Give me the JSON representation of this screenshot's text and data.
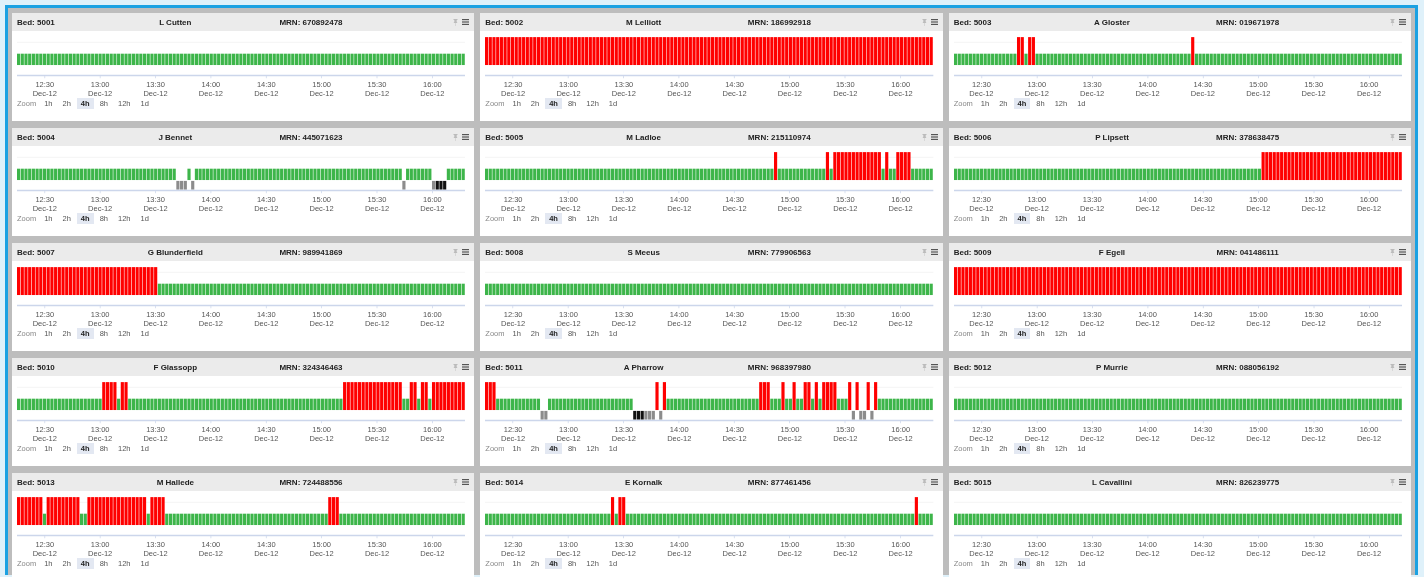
{
  "beds": [
    {
      "bed": "Bed: 5001",
      "patient": "L Cutten",
      "mrn": "MRN: 670892478",
      "segments": [
        {
          "kind": "normal"
        }
      ],
      "axis": [
        {
          "time": "12:30",
          "date": "Dec-12"
        },
        {
          "time": "13:00",
          "date": "Dec-12"
        },
        {
          "time": "13:30",
          "date": "Dec-12"
        },
        {
          "time": "14:00",
          "date": "Dec-12"
        },
        {
          "time": "14:30",
          "date": "Dec-12"
        },
        {
          "time": "15:00",
          "date": "Dec-12"
        },
        {
          "time": "15:30",
          "date": "Dec-12"
        },
        {
          "time": "16:00",
          "date": "Dec-12"
        }
      ],
      "zoom": {
        "label": "Zoom",
        "options": [
          {
            "label": "1h",
            "selected": false
          },
          {
            "label": "2h",
            "selected": false
          },
          {
            "label": "4h",
            "selected": true
          },
          {
            "label": "8h",
            "selected": false
          },
          {
            "label": "12h",
            "selected": false
          },
          {
            "label": "1d",
            "selected": false
          }
        ]
      }
    },
    {
      "bed": "Bed: 5002",
      "patient": "M Lelliott",
      "mrn": "MRN: 186992918",
      "segments": [
        {
          "kind": "alarm"
        }
      ],
      "axis": [
        {
          "time": "12:30",
          "date": "Dec-12"
        },
        {
          "time": "13:00",
          "date": "Dec-12"
        },
        {
          "time": "13:30",
          "date": "Dec-12"
        },
        {
          "time": "14:00",
          "date": "Dec-12"
        },
        {
          "time": "14:30",
          "date": "Dec-12"
        },
        {
          "time": "15:00",
          "date": "Dec-12"
        },
        {
          "time": "15:30",
          "date": "Dec-12"
        },
        {
          "time": "16:00",
          "date": "Dec-12"
        }
      ],
      "zoom": {
        "label": "Zoom",
        "options": [
          {
            "label": "1h",
            "selected": false
          },
          {
            "label": "2h",
            "selected": false
          },
          {
            "label": "4h",
            "selected": true
          },
          {
            "label": "8h",
            "selected": false
          },
          {
            "label": "12h",
            "selected": false
          },
          {
            "label": "1d",
            "selected": false
          }
        ]
      }
    },
    {
      "bed": "Bed: 5003",
      "patient": "A Gloster",
      "mrn": "MRN: 019671978",
      "segments": [
        {
          "kind": "normal"
        },
        {
          "kind": "alarm"
        },
        {
          "kind": "normal"
        },
        {
          "kind": "alarm"
        },
        {
          "kind": "normal"
        },
        {
          "kind": "alarm"
        },
        {
          "kind": "normal"
        }
      ],
      "axis": [
        {
          "time": "12:30",
          "date": "Dec-12"
        },
        {
          "time": "13:00",
          "date": "Dec-12"
        },
        {
          "time": "13:30",
          "date": "Dec-12"
        },
        {
          "time": "14:00",
          "date": "Dec-12"
        },
        {
          "time": "14:30",
          "date": "Dec-12"
        },
        {
          "time": "15:00",
          "date": "Dec-12"
        },
        {
          "time": "15:30",
          "date": "Dec-12"
        },
        {
          "time": "16:00",
          "date": "Dec-12"
        }
      ],
      "zoom": {
        "label": "Zoom",
        "options": [
          {
            "label": "1h",
            "selected": false
          },
          {
            "label": "2h",
            "selected": false
          },
          {
            "label": "4h",
            "selected": true
          },
          {
            "label": "8h",
            "selected": false
          },
          {
            "label": "12h",
            "selected": false
          },
          {
            "label": "1d",
            "selected": false
          }
        ]
      }
    },
    {
      "bed": "Bed: 5004",
      "patient": "J Bennet",
      "mrn": "MRN: 445071623",
      "segments": [
        {
          "kind": "normal"
        },
        {
          "kind": "gap"
        },
        {
          "kind": "normal"
        },
        {
          "kind": "gap"
        },
        {
          "kind": "normal"
        },
        {
          "kind": "gap"
        },
        {
          "kind": "normal"
        },
        {
          "kind": "gap"
        },
        {
          "kind": "dark_gap"
        },
        {
          "kind": "normal"
        }
      ],
      "axis": [
        {
          "time": "12:30",
          "date": "Dec-12"
        },
        {
          "time": "13:00",
          "date": "Dec-12"
        },
        {
          "time": "13:30",
          "date": "Dec-12"
        },
        {
          "time": "14:00",
          "date": "Dec-12"
        },
        {
          "time": "14:30",
          "date": "Dec-12"
        },
        {
          "time": "15:00",
          "date": "Dec-12"
        },
        {
          "time": "15:30",
          "date": "Dec-12"
        },
        {
          "time": "16:00",
          "date": "Dec-12"
        }
      ],
      "zoom": {
        "label": "Zoom",
        "options": [
          {
            "label": "1h",
            "selected": false
          },
          {
            "label": "2h",
            "selected": false
          },
          {
            "label": "4h",
            "selected": true
          },
          {
            "label": "8h",
            "selected": false
          },
          {
            "label": "12h",
            "selected": false
          },
          {
            "label": "1d",
            "selected": false
          }
        ]
      }
    },
    {
      "bed": "Bed: 5005",
      "patient": "M Ladloe",
      "mrn": "MRN: 215110974",
      "segments": [
        {
          "kind": "normal"
        },
        {
          "kind": "alarm"
        },
        {
          "kind": "normal"
        },
        {
          "kind": "alarm"
        },
        {
          "kind": "normal"
        },
        {
          "kind": "alarm"
        },
        {
          "kind": "normal"
        },
        {
          "kind": "alarm"
        },
        {
          "kind": "normal"
        },
        {
          "kind": "alarm"
        },
        {
          "kind": "normal"
        }
      ],
      "axis": [
        {
          "time": "12:30",
          "date": "Dec-12"
        },
        {
          "time": "13:00",
          "date": "Dec-12"
        },
        {
          "time": "13:30",
          "date": "Dec-12"
        },
        {
          "time": "14:00",
          "date": "Dec-12"
        },
        {
          "time": "14:30",
          "date": "Dec-12"
        },
        {
          "time": "15:00",
          "date": "Dec-12"
        },
        {
          "time": "15:30",
          "date": "Dec-12"
        },
        {
          "time": "16:00",
          "date": "Dec-12"
        }
      ],
      "zoom": {
        "label": "Zoom",
        "options": [
          {
            "label": "1h",
            "selected": false
          },
          {
            "label": "2h",
            "selected": false
          },
          {
            "label": "4h",
            "selected": true
          },
          {
            "label": "8h",
            "selected": false
          },
          {
            "label": "12h",
            "selected": false
          },
          {
            "label": "1d",
            "selected": false
          }
        ]
      }
    },
    {
      "bed": "Bed: 5006",
      "patient": "P Lipsett",
      "mrn": "MRN: 378638475",
      "segments": [
        {
          "kind": "normal"
        },
        {
          "kind": "alarm"
        }
      ],
      "axis": [
        {
          "time": "12:30",
          "date": "Dec-12"
        },
        {
          "time": "13:00",
          "date": "Dec-12"
        },
        {
          "time": "13:30",
          "date": "Dec-12"
        },
        {
          "time": "14:00",
          "date": "Dec-12"
        },
        {
          "time": "14:30",
          "date": "Dec-12"
        },
        {
          "time": "15:00",
          "date": "Dec-12"
        },
        {
          "time": "15:30",
          "date": "Dec-12"
        },
        {
          "time": "16:00",
          "date": "Dec-12"
        }
      ],
      "zoom": {
        "label": "Zoom",
        "options": [
          {
            "label": "1h",
            "selected": false
          },
          {
            "label": "2h",
            "selected": false
          },
          {
            "label": "4h",
            "selected": true
          },
          {
            "label": "8h",
            "selected": false
          },
          {
            "label": "12h",
            "selected": false
          },
          {
            "label": "1d",
            "selected": false
          }
        ]
      }
    },
    {
      "bed": "Bed: 5007",
      "patient": "G Blunderfield",
      "mrn": "MRN: 989941869",
      "segments": [
        {
          "kind": "alarm"
        },
        {
          "kind": "normal"
        }
      ],
      "axis": [
        {
          "time": "12:30",
          "date": "Dec-12"
        },
        {
          "time": "13:00",
          "date": "Dec-12"
        },
        {
          "time": "13:30",
          "date": "Dec-12"
        },
        {
          "time": "14:00",
          "date": "Dec-12"
        },
        {
          "time": "14:30",
          "date": "Dec-12"
        },
        {
          "time": "15:00",
          "date": "Dec-12"
        },
        {
          "time": "15:30",
          "date": "Dec-12"
        },
        {
          "time": "16:00",
          "date": "Dec-12"
        }
      ],
      "zoom": {
        "label": "Zoom",
        "options": [
          {
            "label": "1h",
            "selected": false
          },
          {
            "label": "2h",
            "selected": false
          },
          {
            "label": "4h",
            "selected": true
          },
          {
            "label": "8h",
            "selected": false
          },
          {
            "label": "12h",
            "selected": false
          },
          {
            "label": "1d",
            "selected": false
          }
        ]
      }
    },
    {
      "bed": "Bed: 5008",
      "patient": "S Meeus",
      "mrn": "MRN: 779906563",
      "segments": [
        {
          "kind": "normal"
        }
      ],
      "axis": [
        {
          "time": "12:30",
          "date": "Dec-12"
        },
        {
          "time": "13:00",
          "date": "Dec-12"
        },
        {
          "time": "13:30",
          "date": "Dec-12"
        },
        {
          "time": "14:00",
          "date": "Dec-12"
        },
        {
          "time": "14:30",
          "date": "Dec-12"
        },
        {
          "time": "15:00",
          "date": "Dec-12"
        },
        {
          "time": "15:30",
          "date": "Dec-12"
        },
        {
          "time": "16:00",
          "date": "Dec-12"
        }
      ],
      "zoom": {
        "label": "Zoom",
        "options": [
          {
            "label": "1h",
            "selected": false
          },
          {
            "label": "2h",
            "selected": false
          },
          {
            "label": "4h",
            "selected": true
          },
          {
            "label": "8h",
            "selected": false
          },
          {
            "label": "12h",
            "selected": false
          },
          {
            "label": "1d",
            "selected": false
          }
        ]
      }
    },
    {
      "bed": "Bed: 5009",
      "patient": "F Egell",
      "mrn": "MRN: 041486111",
      "segments": [
        {
          "kind": "alarm"
        }
      ],
      "axis": [
        {
          "time": "12:30",
          "date": "Dec-12"
        },
        {
          "time": "13:00",
          "date": "Dec-12"
        },
        {
          "time": "13:30",
          "date": "Dec-12"
        },
        {
          "time": "14:00",
          "date": "Dec-12"
        },
        {
          "time": "14:30",
          "date": "Dec-12"
        },
        {
          "time": "15:00",
          "date": "Dec-12"
        },
        {
          "time": "15:30",
          "date": "Dec-12"
        },
        {
          "time": "16:00",
          "date": "Dec-12"
        }
      ],
      "zoom": {
        "label": "Zoom",
        "options": [
          {
            "label": "1h",
            "selected": false
          },
          {
            "label": "2h",
            "selected": false
          },
          {
            "label": "4h",
            "selected": true
          },
          {
            "label": "8h",
            "selected": false
          },
          {
            "label": "12h",
            "selected": false
          },
          {
            "label": "1d",
            "selected": false
          }
        ]
      }
    },
    {
      "bed": "Bed: 5010",
      "patient": "F Glassopp",
      "mrn": "MRN: 324346463",
      "segments": [
        {
          "kind": "normal"
        },
        {
          "kind": "alarm"
        },
        {
          "kind": "normal"
        },
        {
          "kind": "alarm"
        },
        {
          "kind": "normal"
        },
        {
          "kind": "alarm"
        },
        {
          "kind": "normal"
        },
        {
          "kind": "alarm"
        },
        {
          "kind": "normal"
        },
        {
          "kind": "alarm"
        },
        {
          "kind": "normal"
        },
        {
          "kind": "alarm"
        }
      ],
      "axis": [
        {
          "time": "12:30",
          "date": "Dec-12"
        },
        {
          "time": "13:00",
          "date": "Dec-12"
        },
        {
          "time": "13:30",
          "date": "Dec-12"
        },
        {
          "time": "14:00",
          "date": "Dec-12"
        },
        {
          "time": "14:30",
          "date": "Dec-12"
        },
        {
          "time": "15:00",
          "date": "Dec-12"
        },
        {
          "time": "15:30",
          "date": "Dec-12"
        },
        {
          "time": "16:00",
          "date": "Dec-12"
        }
      ],
      "zoom": {
        "label": "Zoom",
        "options": [
          {
            "label": "1h",
            "selected": false
          },
          {
            "label": "2h",
            "selected": false
          },
          {
            "label": "4h",
            "selected": true
          },
          {
            "label": "8h",
            "selected": false
          },
          {
            "label": "12h",
            "selected": false
          },
          {
            "label": "1d",
            "selected": false
          }
        ]
      }
    },
    {
      "bed": "Bed: 5011",
      "patient": "A Pharrow",
      "mrn": "MRN: 968397980",
      "segments": [
        {
          "kind": "alarm"
        },
        {
          "kind": "normal"
        },
        {
          "kind": "gap"
        },
        {
          "kind": "normal"
        },
        {
          "kind": "dark_gap"
        },
        {
          "kind": "gap"
        },
        {
          "kind": "alarm"
        },
        {
          "kind": "gap"
        },
        {
          "kind": "alarm"
        },
        {
          "kind": "normal"
        },
        {
          "kind": "alarm"
        },
        {
          "kind": "normal"
        },
        {
          "kind": "alarm"
        },
        {
          "kind": "normal"
        },
        {
          "kind": "alarm"
        },
        {
          "kind": "normal"
        },
        {
          "kind": "alarm"
        },
        {
          "kind": "normal"
        },
        {
          "kind": "alarm"
        },
        {
          "kind": "normal"
        },
        {
          "kind": "alarm"
        },
        {
          "kind": "normal"
        },
        {
          "kind": "alarm"
        },
        {
          "kind": "gap"
        },
        {
          "kind": "alarm"
        },
        {
          "kind": "gap"
        },
        {
          "kind": "alarm"
        },
        {
          "kind": "gap"
        },
        {
          "kind": "alarm"
        },
        {
          "kind": "normal"
        }
      ],
      "axis": [
        {
          "time": "12:30",
          "date": "Dec-12"
        },
        {
          "time": "13:00",
          "date": "Dec-12"
        },
        {
          "time": "13:30",
          "date": "Dec-12"
        },
        {
          "time": "14:00",
          "date": "Dec-12"
        },
        {
          "time": "14:30",
          "date": "Dec-12"
        },
        {
          "time": "15:00",
          "date": "Dec-12"
        },
        {
          "time": "15:30",
          "date": "Dec-12"
        },
        {
          "time": "16:00",
          "date": "Dec-12"
        }
      ],
      "zoom": {
        "label": "Zoom",
        "options": [
          {
            "label": "1h",
            "selected": false
          },
          {
            "label": "2h",
            "selected": false
          },
          {
            "label": "4h",
            "selected": true
          },
          {
            "label": "8h",
            "selected": false
          },
          {
            "label": "12h",
            "selected": false
          },
          {
            "label": "1d",
            "selected": false
          }
        ]
      }
    },
    {
      "bed": "Bed: 5012",
      "patient": "P Murrie",
      "mrn": "MRN: 088056192",
      "segments": [
        {
          "kind": "normal"
        }
      ],
      "axis": [
        {
          "time": "12:30",
          "date": "Dec-12"
        },
        {
          "time": "13:00",
          "date": "Dec-12"
        },
        {
          "time": "13:30",
          "date": "Dec-12"
        },
        {
          "time": "14:00",
          "date": "Dec-12"
        },
        {
          "time": "14:30",
          "date": "Dec-12"
        },
        {
          "time": "15:00",
          "date": "Dec-12"
        },
        {
          "time": "15:30",
          "date": "Dec-12"
        },
        {
          "time": "16:00",
          "date": "Dec-12"
        }
      ],
      "zoom": {
        "label": "Zoom",
        "options": [
          {
            "label": "1h",
            "selected": false
          },
          {
            "label": "2h",
            "selected": false
          },
          {
            "label": "4h",
            "selected": true
          },
          {
            "label": "8h",
            "selected": false
          },
          {
            "label": "12h",
            "selected": false
          },
          {
            "label": "1d",
            "selected": false
          }
        ]
      }
    },
    {
      "bed": "Bed: 5013",
      "patient": "M Hallede",
      "mrn": "MRN: 724488556",
      "segments": [
        {
          "kind": "alarm"
        },
        {
          "kind": "normal"
        },
        {
          "kind": "alarm"
        },
        {
          "kind": "normal"
        },
        {
          "kind": "alarm"
        },
        {
          "kind": "normal"
        },
        {
          "kind": "alarm"
        },
        {
          "kind": "normal"
        },
        {
          "kind": "alarm"
        },
        {
          "kind": "normal"
        }
      ],
      "axis": [
        {
          "time": "12:30",
          "date": "Dec-12"
        },
        {
          "time": "13:00",
          "date": "Dec-12"
        },
        {
          "time": "13:30",
          "date": "Dec-12"
        },
        {
          "time": "14:00",
          "date": "Dec-12"
        },
        {
          "time": "14:30",
          "date": "Dec-12"
        },
        {
          "time": "15:00",
          "date": "Dec-12"
        },
        {
          "time": "15:30",
          "date": "Dec-12"
        },
        {
          "time": "16:00",
          "date": "Dec-12"
        }
      ],
      "zoom": {
        "label": "Zoom",
        "options": [
          {
            "label": "1h",
            "selected": false
          },
          {
            "label": "2h",
            "selected": false
          },
          {
            "label": "4h",
            "selected": true
          },
          {
            "label": "8h",
            "selected": false
          },
          {
            "label": "12h",
            "selected": false
          },
          {
            "label": "1d",
            "selected": false
          }
        ]
      }
    },
    {
      "bed": "Bed: 5014",
      "patient": "E Kornalk",
      "mrn": "MRN: 877461456",
      "segments": [
        {
          "kind": "normal"
        },
        {
          "kind": "alarm"
        },
        {
          "kind": "normal"
        },
        {
          "kind": "alarm"
        },
        {
          "kind": "normal"
        },
        {
          "kind": "alarm"
        },
        {
          "kind": "normal"
        }
      ],
      "axis": [
        {
          "time": "12:30",
          "date": "Dec-12"
        },
        {
          "time": "13:00",
          "date": "Dec-12"
        },
        {
          "time": "13:30",
          "date": "Dec-12"
        },
        {
          "time": "14:00",
          "date": "Dec-12"
        },
        {
          "time": "14:30",
          "date": "Dec-12"
        },
        {
          "time": "15:00",
          "date": "Dec-12"
        },
        {
          "time": "15:30",
          "date": "Dec-12"
        },
        {
          "time": "16:00",
          "date": "Dec-12"
        }
      ],
      "zoom": {
        "label": "Zoom",
        "options": [
          {
            "label": "1h",
            "selected": false
          },
          {
            "label": "2h",
            "selected": false
          },
          {
            "label": "4h",
            "selected": true
          },
          {
            "label": "8h",
            "selected": false
          },
          {
            "label": "12h",
            "selected": false
          },
          {
            "label": "1d",
            "selected": false
          }
        ]
      }
    },
    {
      "bed": "Bed: 5015",
      "patient": "L Cavallini",
      "mrn": "MRN: 826239775",
      "segments": [
        {
          "kind": "normal"
        }
      ],
      "axis": [
        {
          "time": "12:30",
          "date": "Dec-12"
        },
        {
          "time": "13:00",
          "date": "Dec-12"
        },
        {
          "time": "13:30",
          "date": "Dec-12"
        },
        {
          "time": "14:00",
          "date": "Dec-12"
        },
        {
          "time": "14:30",
          "date": "Dec-12"
        },
        {
          "time": "15:00",
          "date": "Dec-12"
        },
        {
          "time": "15:30",
          "date": "Dec-12"
        },
        {
          "time": "16:00",
          "date": "Dec-12"
        }
      ],
      "zoom": {
        "label": "Zoom",
        "options": [
          {
            "label": "1h",
            "selected": false
          },
          {
            "label": "2h",
            "selected": false
          },
          {
            "label": "4h",
            "selected": true
          },
          {
            "label": "8h",
            "selected": false
          },
          {
            "label": "12h",
            "selected": false
          },
          {
            "label": "1d",
            "selected": false
          }
        ]
      }
    }
  ]
}
